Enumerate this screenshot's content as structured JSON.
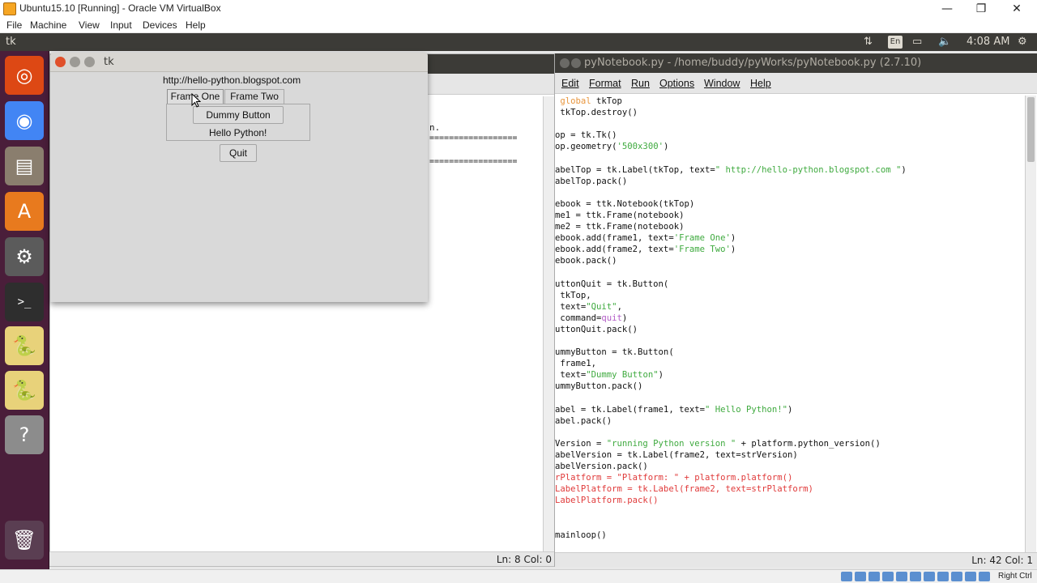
{
  "vbox": {
    "title": "Ubuntu15.10 [Running] - Oracle VM VirtualBox",
    "menu": [
      "File",
      "Machine",
      "View",
      "Input",
      "Devices",
      "Help"
    ],
    "minimize": "—",
    "restore": "❐",
    "close": "✕",
    "host_key": "Right Ctrl"
  },
  "ubuntu_panel": {
    "app_name": "tk",
    "lang": "En",
    "time": "4:08 AM",
    "net_icon": "⇅",
    "battery_icon": "▭",
    "volume_icon": "🔈",
    "settings_icon": "⚙"
  },
  "launcher": [
    {
      "name": "ubuntu-dash",
      "glyph": "◎",
      "color": "#dd4814"
    },
    {
      "name": "chrome",
      "glyph": "◉",
      "color": "#4285f4"
    },
    {
      "name": "files",
      "glyph": "▤",
      "color": "#8a7e6e"
    },
    {
      "name": "software-center",
      "glyph": "A",
      "color": "#e87a1e"
    },
    {
      "name": "system-settings",
      "glyph": "⚙",
      "color": "#5b5b5b"
    },
    {
      "name": "terminal",
      "glyph": ">_",
      "color": "#2e2e2e"
    },
    {
      "name": "python-idle-1",
      "glyph": "🐍",
      "color": "#e8d27a"
    },
    {
      "name": "python-idle-2",
      "glyph": "🐍",
      "color": "#e8d27a"
    },
    {
      "name": "unknown-app",
      "glyph": "?",
      "color": "#8c8c8c"
    },
    {
      "name": "trash",
      "glyph": "🗑",
      "color": "#5a3e52"
    }
  ],
  "shell_window": {
    "status": "Ln: 8 Col: 0",
    "visible_fragment": "n.",
    "dashes_1": "==================",
    "dashes_2": "=================="
  },
  "editor": {
    "title": "pyNotebook.py - /home/buddy/pyWorks/pyNotebook.py (2.7.10)",
    "menu": [
      "Edit",
      "Format",
      "Run",
      "Options",
      "Window",
      "Help"
    ],
    "status": "Ln: 42 Col: 1",
    "code": [
      [
        [
          "kw",
          " global"
        ],
        [
          "",
          " tkTop"
        ]
      ],
      [
        [
          "",
          " tkTop.destroy()"
        ]
      ],
      [
        [
          "",
          ""
        ]
      ],
      [
        [
          "",
          "op = tk.Tk()"
        ]
      ],
      [
        [
          "",
          "op.geometry("
        ],
        [
          "str",
          "'500x300'"
        ],
        [
          "",
          ")"
        ]
      ],
      [
        [
          "",
          ""
        ]
      ],
      [
        [
          "",
          "abelTop = tk.Label(tkTop, text="
        ],
        [
          "str",
          "\" http://hello-python.blogspot.com \""
        ],
        [
          "",
          ")"
        ]
      ],
      [
        [
          "",
          "abelTop.pack()"
        ]
      ],
      [
        [
          "",
          ""
        ]
      ],
      [
        [
          "",
          "ebook = ttk.Notebook(tkTop)"
        ]
      ],
      [
        [
          "",
          "me1 = ttk.Frame(notebook)"
        ]
      ],
      [
        [
          "",
          "me2 = ttk.Frame(notebook)"
        ]
      ],
      [
        [
          "",
          "ebook.add(frame1, text="
        ],
        [
          "str",
          "'Frame One'"
        ],
        [
          "",
          ")"
        ]
      ],
      [
        [
          "",
          "ebook.add(frame2, text="
        ],
        [
          "str",
          "'Frame Two'"
        ],
        [
          "",
          ")"
        ]
      ],
      [
        [
          "",
          "ebook.pack()"
        ]
      ],
      [
        [
          "",
          ""
        ]
      ],
      [
        [
          "",
          "uttonQuit = tk.Button("
        ]
      ],
      [
        [
          "",
          " tkTop,"
        ]
      ],
      [
        [
          "",
          " text="
        ],
        [
          "str",
          "\"Quit\""
        ],
        [
          "",
          ","
        ]
      ],
      [
        [
          "",
          " command="
        ],
        [
          "bi",
          "quit"
        ],
        [
          "",
          ")"
        ]
      ],
      [
        [
          "",
          "uttonQuit.pack()"
        ]
      ],
      [
        [
          "",
          ""
        ]
      ],
      [
        [
          "",
          "ummyButton = tk.Button("
        ]
      ],
      [
        [
          "",
          " frame1,"
        ]
      ],
      [
        [
          "",
          " text="
        ],
        [
          "str",
          "\"Dummy Button\""
        ],
        [
          "",
          ")"
        ]
      ],
      [
        [
          "",
          "ummyButton.pack()"
        ]
      ],
      [
        [
          "",
          ""
        ]
      ],
      [
        [
          "",
          "abel = tk.Label(frame1, text="
        ],
        [
          "str",
          "\" Hello Python!\""
        ],
        [
          "",
          ")"
        ]
      ],
      [
        [
          "",
          "abel.pack()"
        ]
      ],
      [
        [
          "",
          ""
        ]
      ],
      [
        [
          "",
          "Version = "
        ],
        [
          "str",
          "\"running Python version \""
        ],
        [
          "",
          " + platform.python_version()"
        ]
      ],
      [
        [
          "",
          "abelVersion = tk.Label(frame2, text=strVersion)"
        ]
      ],
      [
        [
          "",
          "abelVersion.pack()"
        ]
      ],
      [
        [
          "red",
          "rPlatform = \"Platform: \" + platform.platform()"
        ]
      ],
      [
        [
          "red",
          "LabelPlatform = tk.Label(frame2, text=strPlatform)"
        ]
      ],
      [
        [
          "red",
          "LabelPlatform.pack()"
        ]
      ],
      [
        [
          "",
          ""
        ]
      ],
      [
        [
          "",
          ""
        ]
      ],
      [
        [
          "",
          "mainloop()"
        ]
      ]
    ]
  },
  "tk_window": {
    "title": "tk",
    "url_label": "http://hello-python.blogspot.com",
    "tabs": [
      "Frame One",
      "Frame Two"
    ],
    "dummy_button": "Dummy Button",
    "hello_label": "Hello Python!",
    "quit_button": "Quit"
  }
}
